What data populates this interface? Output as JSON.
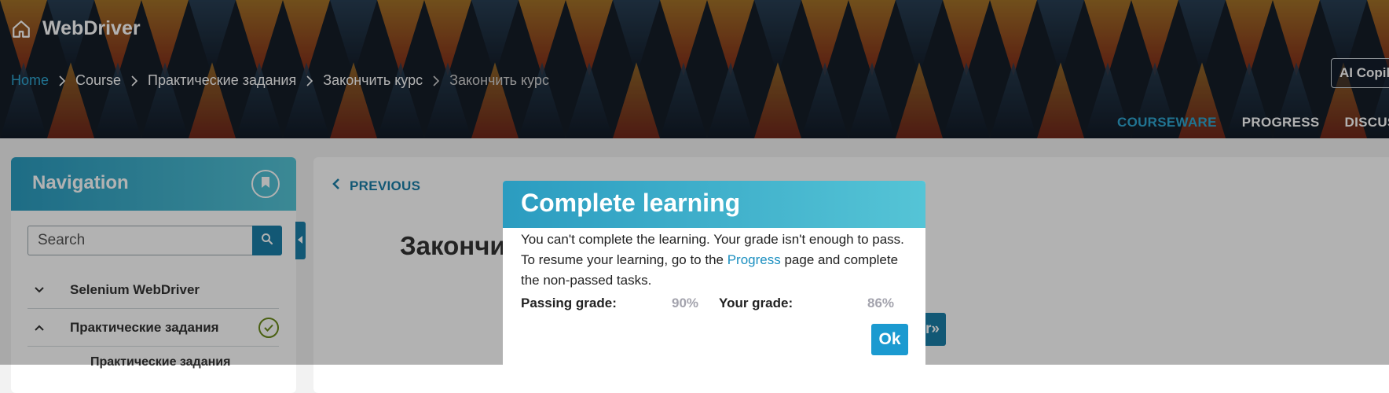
{
  "app": {
    "title": "WebDriver"
  },
  "breadcrumb": [
    "Home",
    "Course",
    "Практические задания",
    "Закончить курс",
    "Закончить курс"
  ],
  "header": {
    "ai_button": "AI Copilot",
    "tabs": [
      "COURSEWARE",
      "PROGRESS",
      "DISCUSSION"
    ]
  },
  "sidebar": {
    "title": "Navigation",
    "search_placeholder": "Search",
    "items": [
      {
        "label": "Selenium WebDriver",
        "expanded": false
      },
      {
        "label": "Практические задания",
        "expanded": true,
        "completed": true
      }
    ],
    "sub_item": "Практические задания"
  },
  "main": {
    "prev_label": "PREVIOUS",
    "title": "Закончить курс",
    "next_label": "r»"
  },
  "modal": {
    "title": "Complete learning",
    "message_before": "You can't complete the learning. Your grade isn't enough to pass. To resume your learning, go to the ",
    "message_link": "Progress",
    "message_after": " page and complete the non-passed tasks.",
    "passing_label": "Passing grade:",
    "passing_value": "90%",
    "your_label": "Your grade:",
    "your_value": "86%",
    "ok_label": "Ok"
  },
  "colors": {
    "accent": "#1b7fa8",
    "link": "#2fa5d0",
    "header_gradient_start": "#2b9cc0",
    "header_gradient_end": "#55c4d6",
    "completed_check": "#6b8a1b"
  }
}
